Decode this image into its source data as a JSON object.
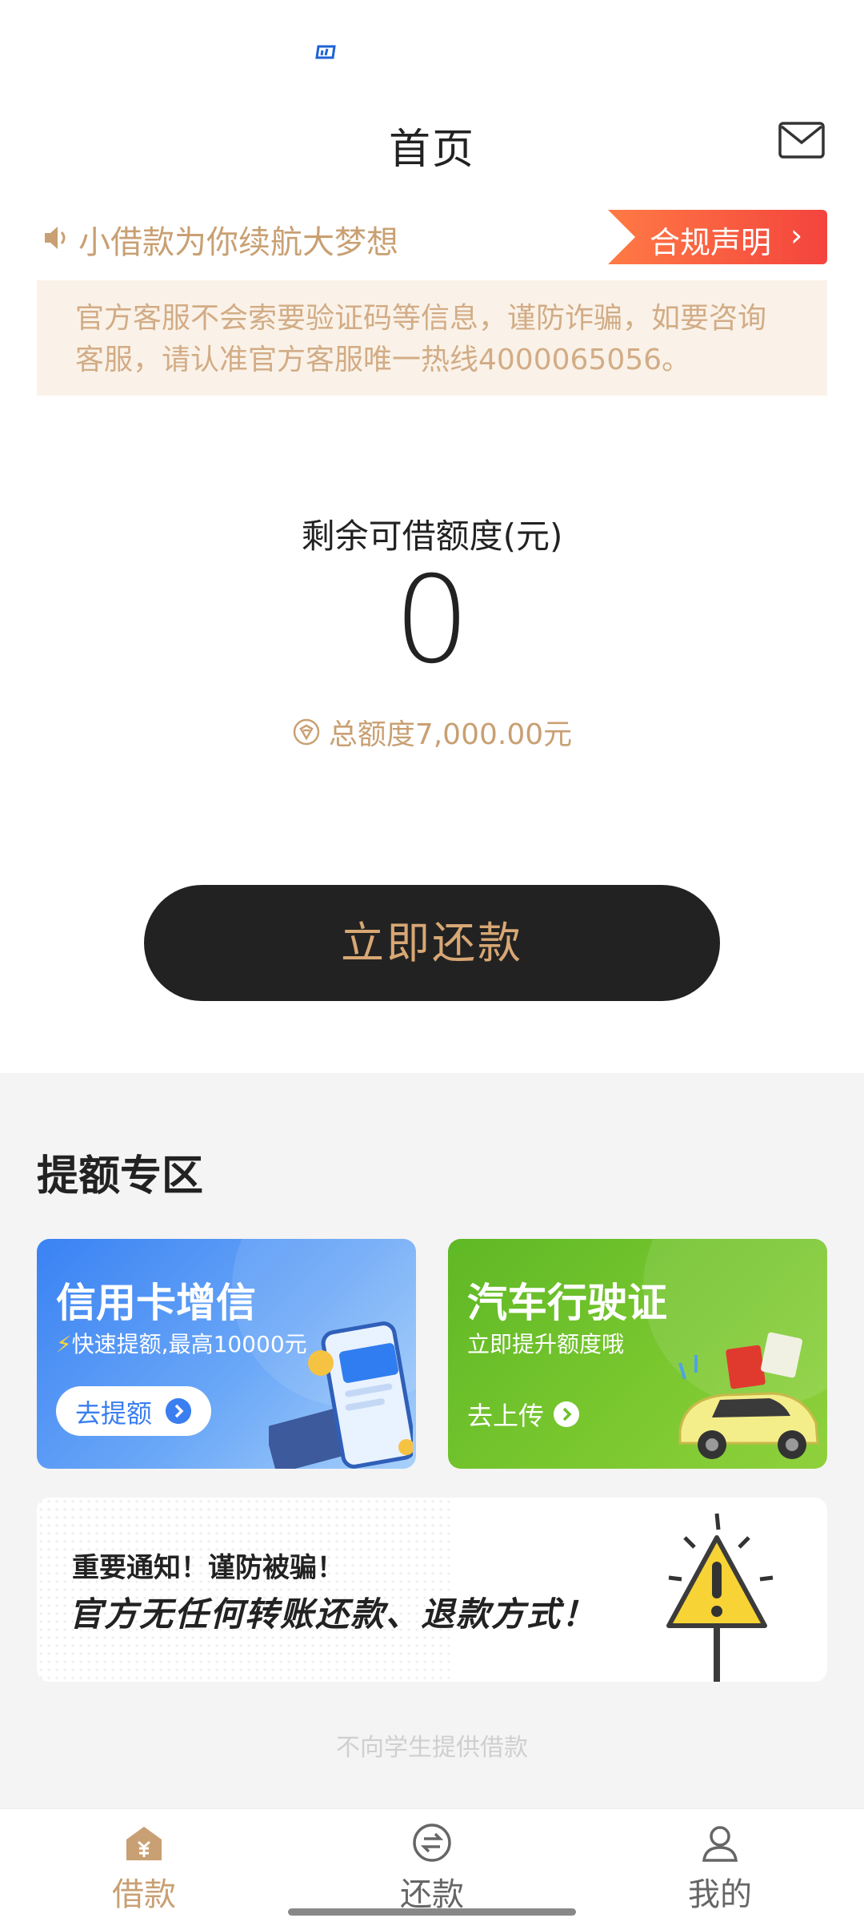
{
  "header": {
    "title": "首页",
    "mail_icon": "mail-icon"
  },
  "notice": {
    "slogan": "小借款为你续航大梦想",
    "compliance_label": "合规声明",
    "compliance_chevron": "›"
  },
  "warning": {
    "text": "官方客服不会索要验证码等信息，谨防诈骗，如要咨询客服，请认准官方客服唯一热线4000065056。"
  },
  "credit": {
    "label": "剩余可借额度(元)",
    "remaining": "0",
    "total_text": "总额度7,000.00元"
  },
  "repay_button": {
    "label": "立即还款"
  },
  "boost_zone": {
    "title": "提额专区",
    "cards": [
      {
        "title": "信用卡增信",
        "subtitle": "快速提额,最高10000元",
        "subtitle_icon": "⚡",
        "button_label": "去提额"
      },
      {
        "title": "汽车行驶证",
        "subtitle": "立即提升额度哦",
        "button_label": "去上传"
      }
    ]
  },
  "alert": {
    "title": "重要通知！谨防被骗！",
    "message": "官方无任何转账还款、退款方式！"
  },
  "footer_note": "不向学生提供借款",
  "tabbar": {
    "items": [
      {
        "label": "借款",
        "icon": "home-loan-icon",
        "active": true
      },
      {
        "label": "还款",
        "icon": "repay-exchange-icon",
        "active": false
      },
      {
        "label": "我的",
        "icon": "user-profile-icon",
        "active": false
      }
    ]
  },
  "colors": {
    "accent_gold": "#c9a073",
    "button_dark": "#232222",
    "compliance_red": "#f3443d",
    "card_blue": "#3a82f3",
    "card_green": "#6cc02a"
  }
}
